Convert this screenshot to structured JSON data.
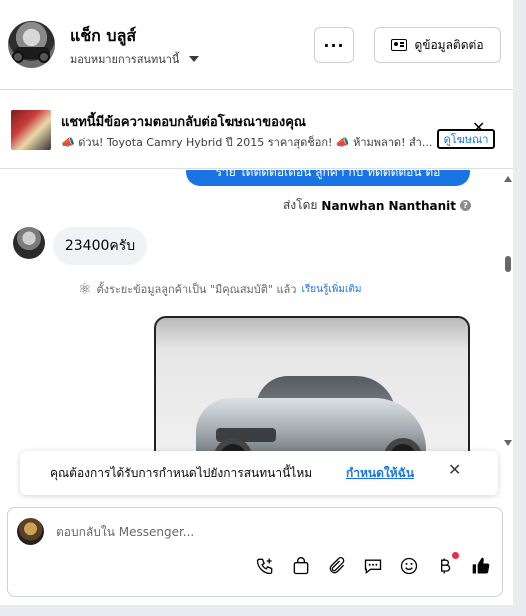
{
  "header": {
    "user_name": "แช็ก บลูส์",
    "assign_label": "มอบหมายการสนทนานี้",
    "more_label": "···",
    "contact_label": "ดูข้อมูลติดต่อ"
  },
  "ad": {
    "title": "แชทนี้มีข้อความตอบกลับต่อโฆษณาของคุณ",
    "snippet": "📣 ด่วน! Toyota Camry Hybrid ปี 2015 ราคาสุดช็อก! 📣 ห้ามพลาด! สำ...",
    "view_label": "ดูโฆษณา",
    "close_label": "✕"
  },
  "chat": {
    "outgoing_text": "ราย ได้ติดต่อเดือน ลูกค้า กับ ทดีติดต่อน ต่อ",
    "sent_by_prefix": "ส่งโดย",
    "sent_by_name": "Nanwhan Nanthanit",
    "incoming_text": "23400ครับ",
    "system_note": "ตั้งระยะข้อมูลลูกค้าเป็น \"มีคุณสมบัติ\" แล้ว",
    "learn_more": "เรียนรู้เพิ่มเติม"
  },
  "suggestion": {
    "text": "คุณต้องการได้รับการกำหนดไปยังการสนทนานี้ไหม",
    "link": "กำหนดให้ฉัน",
    "close_label": "✕"
  },
  "composer": {
    "placeholder": "ตอบกลับใน Messenger..."
  },
  "toolbar_icons": [
    "phone-plus-icon",
    "shopping-bag-icon",
    "paperclip-icon",
    "chat-bubbles-icon",
    "emoji-icon",
    "baht-icon",
    "thumbs-up-icon"
  ],
  "colors": {
    "accent": "#1b74e4",
    "notification_dot": "#f0284a",
    "bubble_in": "#f0f2f5"
  }
}
